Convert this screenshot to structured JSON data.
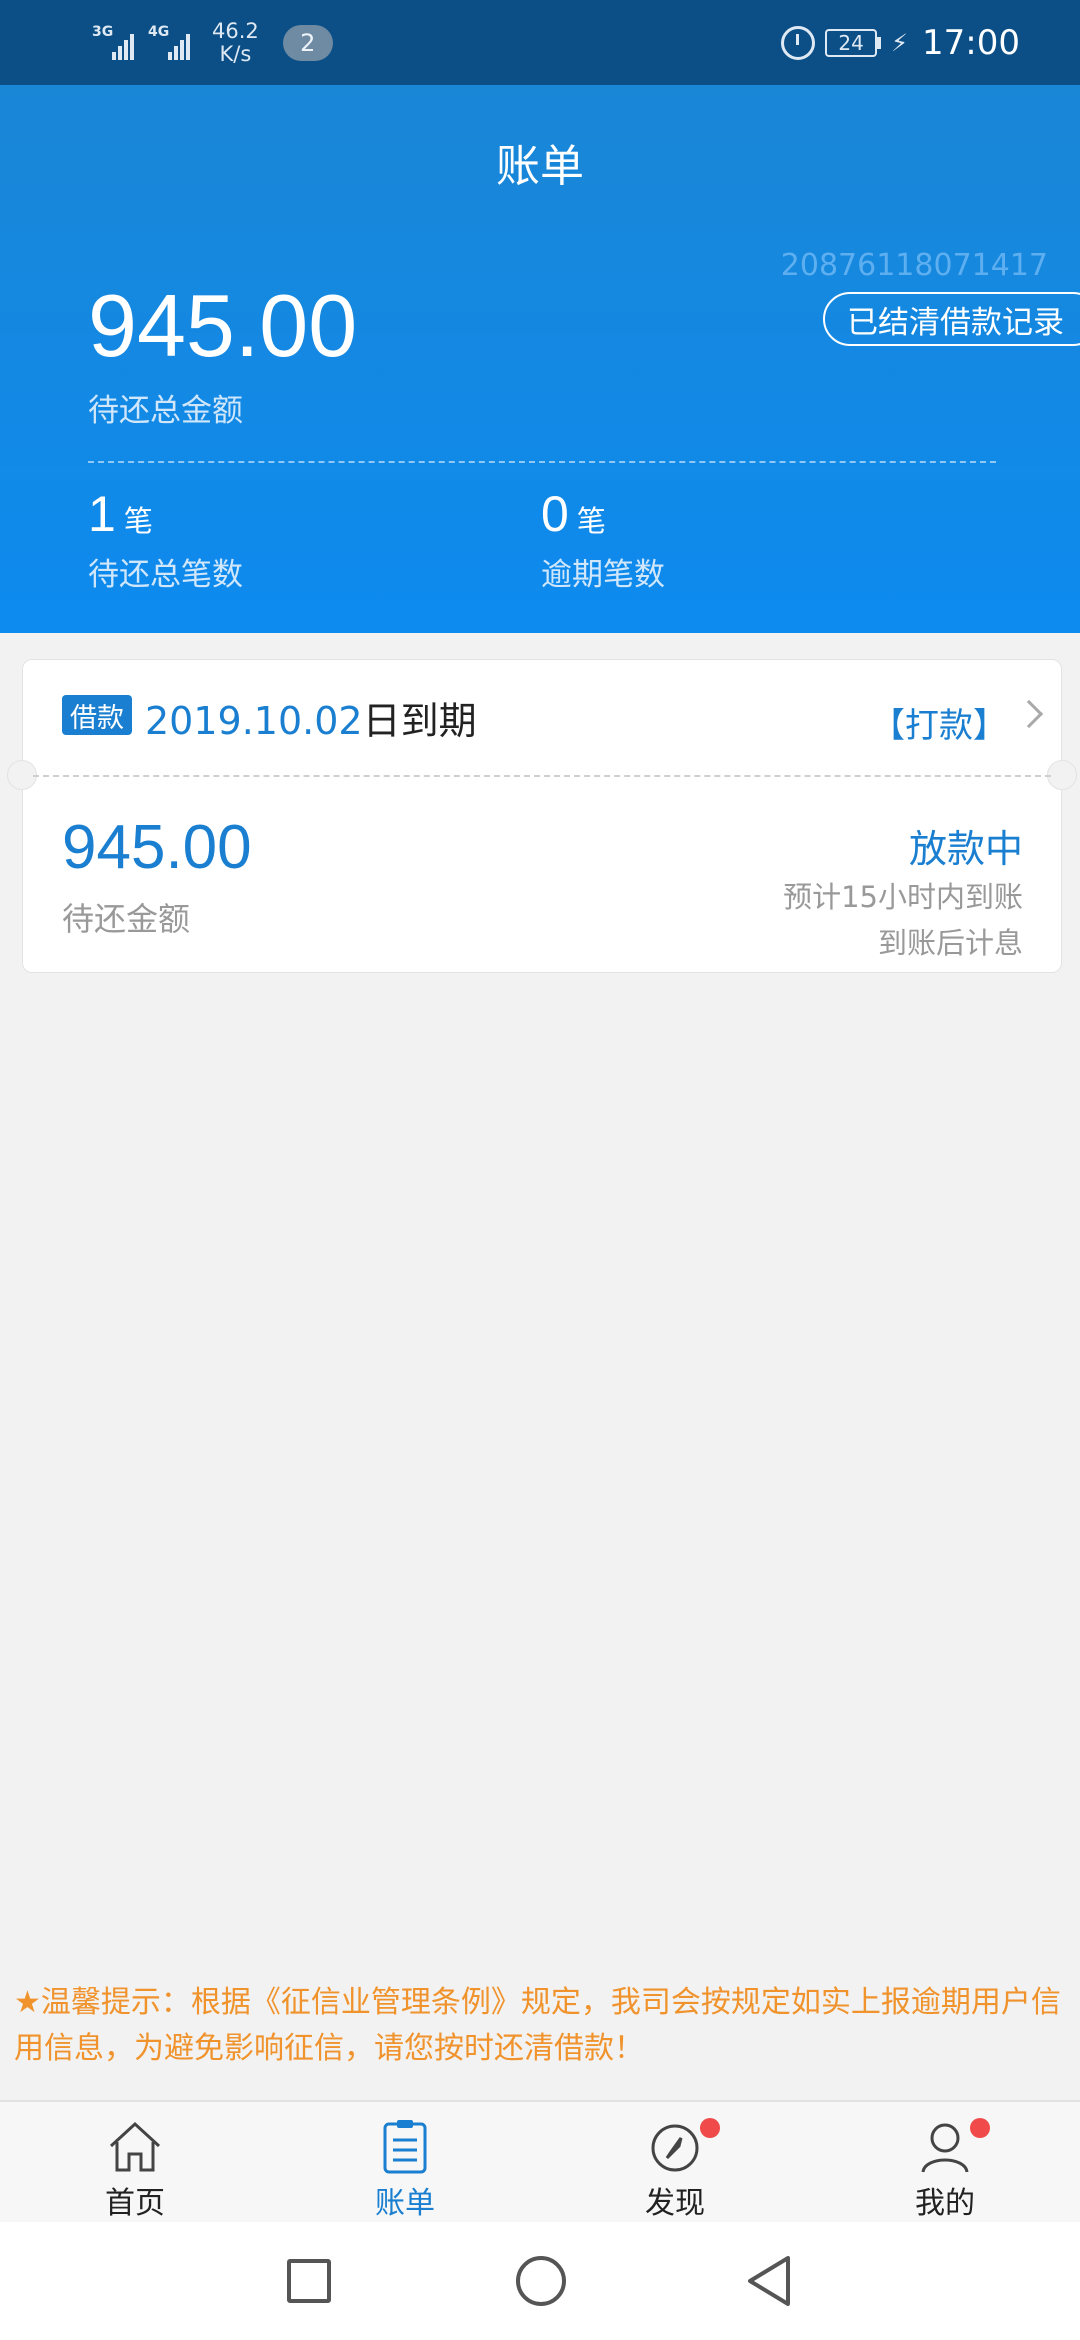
{
  "status_bar": {
    "signal1": "3G",
    "signal2": "4G",
    "net_speed_value": "46.2",
    "net_speed_unit": "K/s",
    "notification_count": "2",
    "battery": "24",
    "time": "17:00"
  },
  "header": {
    "title": "账单",
    "account_number": "20876118071417",
    "settled_button": "已结清借款记录",
    "total_amount": "945.00",
    "total_label": "待还总金额",
    "count_value": "1",
    "count_unit": "笔",
    "count_label": "待还总笔数",
    "overdue_value": "0",
    "overdue_unit": "笔",
    "overdue_label": "逾期笔数"
  },
  "bill_card": {
    "tag": "借款",
    "due_date": "2019.10.02",
    "due_suffix": "日到期",
    "pay_link": "【打款】",
    "amount": "945.00",
    "amount_label": "待还金额",
    "status": "放款中",
    "status_note1": "预计15小时内到账",
    "status_note2": "到账后计息"
  },
  "notice": "★温馨提示：根据《征信业管理条例》规定，我司会按规定如实上报逾期用户信用信息，为避免影响征信，请您按时还清借款！",
  "tabs": [
    {
      "label": "首页",
      "icon": "home-icon"
    },
    {
      "label": "账单",
      "icon": "bill-icon"
    },
    {
      "label": "发现",
      "icon": "compass-icon"
    },
    {
      "label": "我的",
      "icon": "profile-icon"
    }
  ],
  "colors": {
    "primary": "#1a7fd0",
    "header_bg": "#0d8bef",
    "notice": "#f0932c",
    "badge": "#f04a4a"
  }
}
